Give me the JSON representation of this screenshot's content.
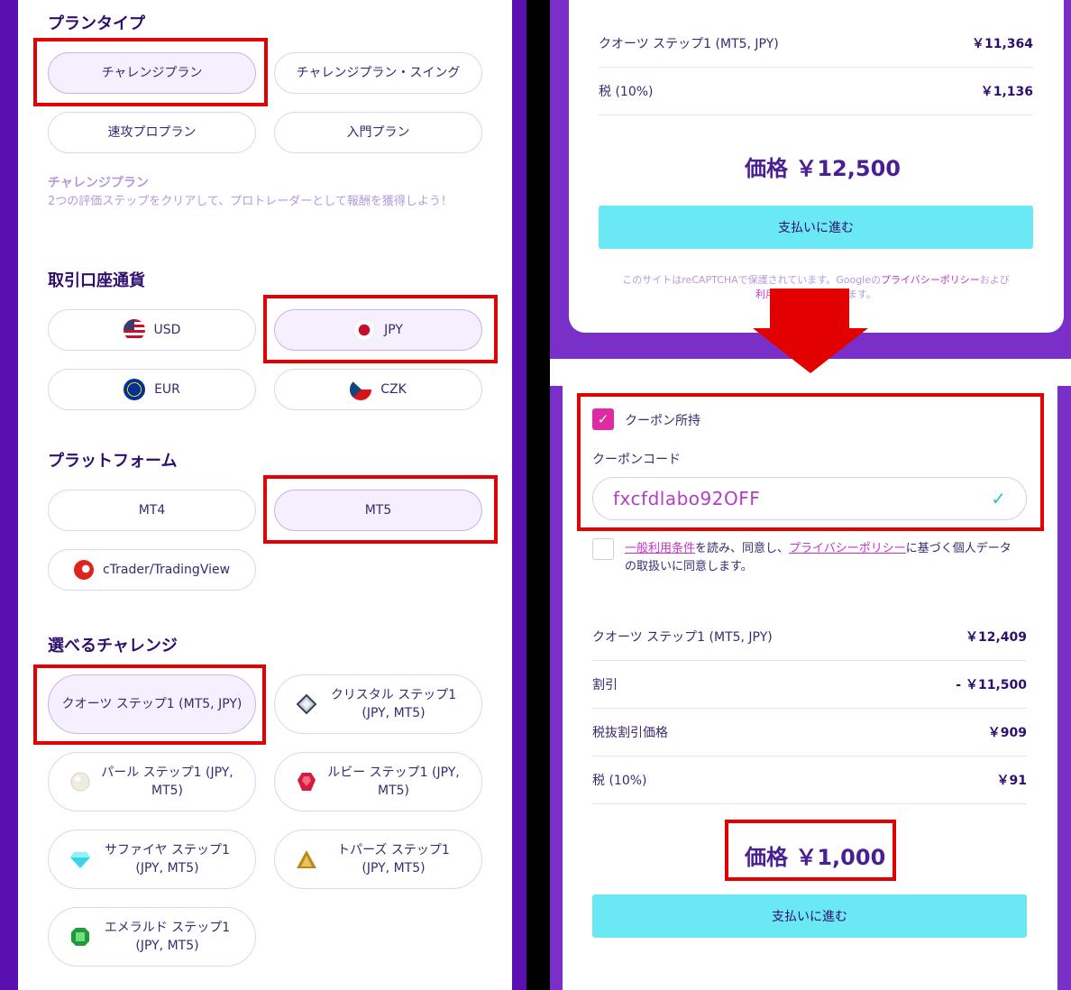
{
  "left": {
    "plan_type": {
      "title": "プランタイプ",
      "options": [
        "チャレンジプラン",
        "チャレンジプラン・スイング",
        "速攻プロプラン",
        "入門プラン"
      ],
      "selected": "チャレンジプラン",
      "desc_title": "チャレンジプラン",
      "desc_text": "2つの評価ステップをクリアして、プロトレーダーとして報酬を獲得しよう！"
    },
    "currency": {
      "title": "取引口座通貨",
      "options": [
        "USD",
        "JPY",
        "EUR",
        "CZK"
      ],
      "selected": "JPY"
    },
    "platform": {
      "title": "プラットフォーム",
      "options": [
        "MT4",
        "MT5",
        "cTrader/TradingView"
      ],
      "selected": "MT5"
    },
    "challenge": {
      "title": "選べるチャレンジ",
      "options": [
        "クオーツ ステップ1 (MT5, JPY)",
        "クリスタル ステップ1 (JPY, MT5)",
        "パール ステップ1 (JPY, MT5)",
        "ルビー ステップ1 (JPY, MT5)",
        "サファイヤ ステップ1 (JPY, MT5)",
        "トパーズ ステップ1 (JPY, MT5)",
        "エメラルド ステップ1 (JPY, MT5)"
      ],
      "selected": "クオーツ ステップ1 (MT5, JPY)"
    }
  },
  "right_top": {
    "rows": [
      {
        "label": "クオーツ ステップ1 (MT5, JPY)",
        "value": "￥11,364"
      },
      {
        "label": "税 (10%)",
        "value": "￥1,136"
      }
    ],
    "price": "価格 ￥12,500",
    "pay_button": "支払いに進む",
    "recaptcha_pre": "このサイトはreCAPTCHAで保護されています。Googleの",
    "recaptcha_link": "プライバシーポリシー",
    "recaptcha_post": "および",
    "recaptcha_line2a": "利用",
    "recaptcha_line2b": "ます。"
  },
  "right_bottom": {
    "coupon_checkbox_label": "クーポン所持",
    "coupon_code_label": "クーポンコード",
    "coupon_code_value": "fxcfdlabo92OFF",
    "terms_link1": "一般利用条件",
    "terms_mid": "を読み、同意し、",
    "terms_link2": "プライバシーポリシー",
    "terms_post": "に基づく個人データの取扱いに同意します。",
    "rows": [
      {
        "label": "クオーツ ステップ1 (MT5, JPY)",
        "value": "￥12,409"
      },
      {
        "label": "割引",
        "value": "- ￥11,500"
      },
      {
        "label": "税抜割引価格",
        "value": "￥909"
      },
      {
        "label": "税 (10%)",
        "value": "￥91"
      }
    ],
    "price": "価格 ￥1,000",
    "pay_button": "支払いに進む"
  },
  "colors": {
    "accent_purple": "#5a10b0",
    "highlight_red": "#e30000",
    "pay_button": "#6ae8f4",
    "coupon_pink": "#e02aa4"
  }
}
